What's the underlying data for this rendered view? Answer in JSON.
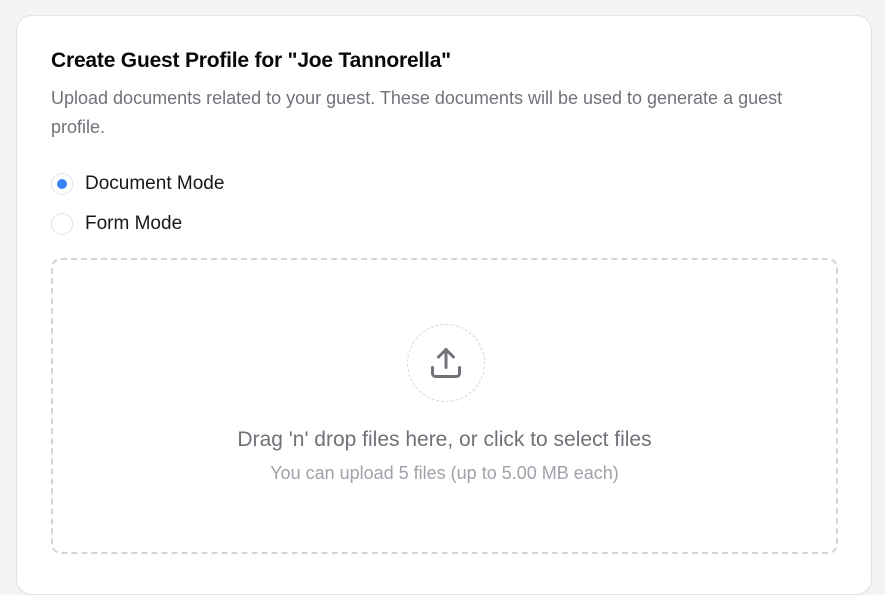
{
  "profile": {
    "title": "Create Guest Profile for \"Joe Tannorella\"",
    "description": "Upload documents related to your guest. These documents will be used to generate a guest profile."
  },
  "modes": {
    "document": {
      "label": "Document Mode",
      "selected": true
    },
    "form": {
      "label": "Form Mode",
      "selected": false
    }
  },
  "upload": {
    "icon": "upload-icon",
    "primary_text": "Drag 'n' drop files here, or click to select files",
    "secondary_text": "You can upload 5 files (up to 5.00 MB each)"
  },
  "colors": {
    "accent": "#3b82f6",
    "muted_text": "#71717a",
    "dashed_border": "#d4d4d8"
  }
}
